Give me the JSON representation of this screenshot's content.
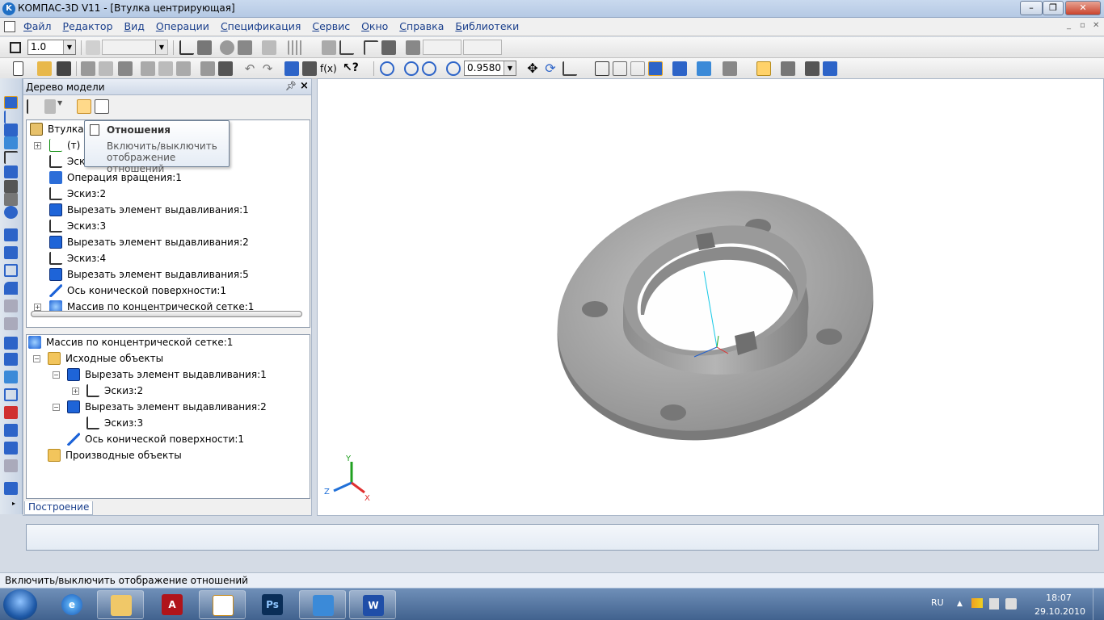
{
  "window": {
    "title": "КОМПАС-3D V11 - [Втулка центрирующая]"
  },
  "menu": [
    "Файл",
    "Редактор",
    "Вид",
    "Операции",
    "Спецификация",
    "Сервис",
    "Окно",
    "Справка",
    "Библиотеки"
  ],
  "toolbar1": {
    "step_value": "1.0"
  },
  "toolbar2": {
    "zoom_value": "0.9580",
    "fx_label": "f(x)"
  },
  "tree_panel": {
    "title": "Дерево модели",
    "root_label": "Втулка ц",
    "upper_items": [
      "(т) Н",
      "Эск",
      "Операция вращения:1",
      "Эскиз:2",
      "Вырезать элемент выдавливания:1",
      "Эскиз:3",
      "Вырезать элемент выдавливания:2",
      "Эскиз:4",
      "Вырезать элемент выдавливания:5",
      "Ось конической поверхности:1",
      "Массив по концентрической сетке:1"
    ],
    "lower_root": "Массив по концентрической сетке:1",
    "lower_items": [
      "Исходные объекты",
      "Вырезать элемент выдавливания:1",
      "Эскиз:2",
      "Вырезать элемент выдавливания:2",
      "Эскиз:3",
      "Ось конической поверхности:1",
      "Производные объекты"
    ],
    "bottom_tab": "Построение"
  },
  "tooltip": {
    "title": "Отношения",
    "description": "Включить/выключить отображение отношений"
  },
  "axes": {
    "x": "X",
    "y": "Y",
    "z": "Z"
  },
  "status_text": "Включить/выключить отображение отношений",
  "taskbar": {
    "lang": "RU",
    "time": "18:07",
    "date": "29.10.2010",
    "ps_label": "Ps",
    "word_label": "W"
  },
  "colors": {
    "accent": "#1e64d8",
    "part_gray": "#a6a6a6",
    "taskbar": "#41628e"
  }
}
